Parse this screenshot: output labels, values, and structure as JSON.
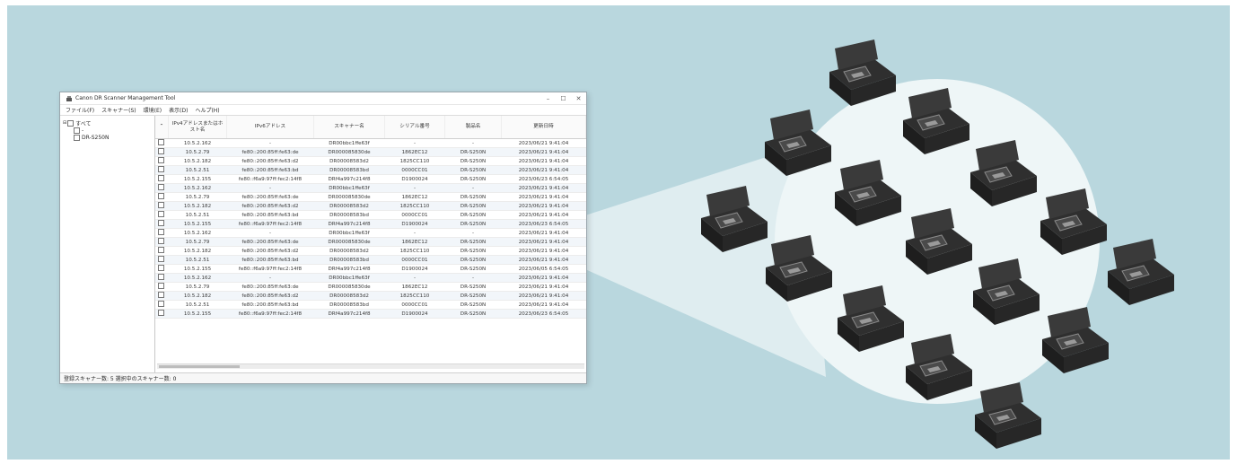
{
  "window": {
    "title": "Canon DR Scanner Management Tool",
    "controls": {
      "minimize": "–",
      "maximize": "☐",
      "close": "✕"
    }
  },
  "menu": [
    {
      "label": "ファイル(F)"
    },
    {
      "label": "スキャナー(S)"
    },
    {
      "label": "環境(E)"
    },
    {
      "label": "表示(D)"
    },
    {
      "label": "ヘルプ(H)"
    }
  ],
  "tree": {
    "root": "すべて",
    "child_blank": "-",
    "child_model": "DR-S250N"
  },
  "table": {
    "columns": [
      "IPv4アドレスまたはホスト名",
      "IPv6アドレス",
      "スキャナー名",
      "シリアル番号",
      "製品名",
      "更新日時"
    ],
    "rows": [
      [
        "10.5.2.162",
        "-",
        "DR00bbc1ffe63f",
        "-",
        "-",
        "2023/06/21 9:41:04"
      ],
      [
        "10.5.2.79",
        "fe80::200:85ff:fe63:de",
        "DR000085830de",
        "1862EC12",
        "DR-S250N",
        "2023/06/21 9:41:04"
      ],
      [
        "10.5.2.182",
        "fe80::200:85ff:fe63:d2",
        "DR00008583d2",
        "1825CC110",
        "DR-S250N",
        "2023/06/21 9:41:04"
      ],
      [
        "10.5.2.51",
        "fe80::200:85ff:fe63:bd",
        "DR00008583bd",
        "0000CC01",
        "DR-S250N",
        "2023/06/21 9:41:04"
      ],
      [
        "10.5.2.155",
        "fe80::f6a9:97ff:fec2:14f8",
        "DRf4a997c214f8",
        "D1900024",
        "DR-S250N",
        "2023/06/23 6:54:05"
      ],
      [
        "10.5.2.162",
        "-",
        "DR00bbc1ffe63f",
        "-",
        "-",
        "2023/06/21 9:41:04"
      ],
      [
        "10.5.2.79",
        "fe80::200:85ff:fe63:de",
        "DR000085830de",
        "1862EC12",
        "DR-S250N",
        "2023/06/21 9:41:04"
      ],
      [
        "10.5.2.182",
        "fe80::200:85ff:fe63:d2",
        "DR00008583d2",
        "1825CC110",
        "DR-S250N",
        "2023/06/21 9:41:04"
      ],
      [
        "10.5.2.51",
        "fe80::200:85ff:fe63:bd",
        "DR00008583bd",
        "0000CC01",
        "DR-S250N",
        "2023/06/21 9:41:04"
      ],
      [
        "10.5.2.155",
        "fe80::f6a9:97ff:fec2:14f8",
        "DRf4a997c214f8",
        "D1900024",
        "DR-S250N",
        "2023/06/23 6:54:05"
      ],
      [
        "10.5.2.162",
        "-",
        "DR00bbc1ffe63f",
        "-",
        "-",
        "2023/06/21 9:41:04"
      ],
      [
        "10.5.2.79",
        "fe80::200:85ff:fe63:de",
        "DR000085830de",
        "1862EC12",
        "DR-S250N",
        "2023/06/21 9:41:04"
      ],
      [
        "10.5.2.182",
        "fe80::200:85ff:fe63:d2",
        "DR00008583d2",
        "1825CC110",
        "DR-S250N",
        "2023/06/21 9:41:04"
      ],
      [
        "10.5.2.51",
        "fe80::200:85ff:fe63:bd",
        "DR00008583bd",
        "0000CC01",
        "DR-S250N",
        "2023/06/21 9:41:04"
      ],
      [
        "10.5.2.155",
        "fe80::f6a9:97ff:fec2:14f8",
        "DRf4a997c214f8",
        "D1900024",
        "DR-S250N",
        "2023/06/05 6:54:05"
      ],
      [
        "10.5.2.162",
        "-",
        "DR00bbc1ffe63f",
        "-",
        "-",
        "2023/06/21 9:41:04"
      ],
      [
        "10.5.2.79",
        "fe80::200:85ff:fe63:de",
        "DR000085830de",
        "1862EC12",
        "DR-S250N",
        "2023/06/21 9:41:04"
      ],
      [
        "10.5.2.182",
        "fe80::200:85ff:fe63:d2",
        "DR00008583d2",
        "1825CC110",
        "DR-S250N",
        "2023/06/21 9:41:04"
      ],
      [
        "10.5.2.51",
        "fe80::200:85ff:fe63:bd",
        "DR00008583bd",
        "0000CC01",
        "DR-S250N",
        "2023/06/21 9:41:04"
      ],
      [
        "10.5.2.155",
        "fe80::f6a9:97ff:fec2:14f8",
        "DRf4a997c214f8",
        "D1900024",
        "DR-S250N",
        "2023/06/23 6:54:05"
      ]
    ]
  },
  "statusbar": {
    "text": "登録スキャナー数: 5  選択中のスキャナー数: 0"
  },
  "illustration": {
    "scanner_count": 16,
    "colors": {
      "background": "#b9d7de",
      "circle": "#eef6f7",
      "scanner_body": "#2f2f2f"
    }
  }
}
